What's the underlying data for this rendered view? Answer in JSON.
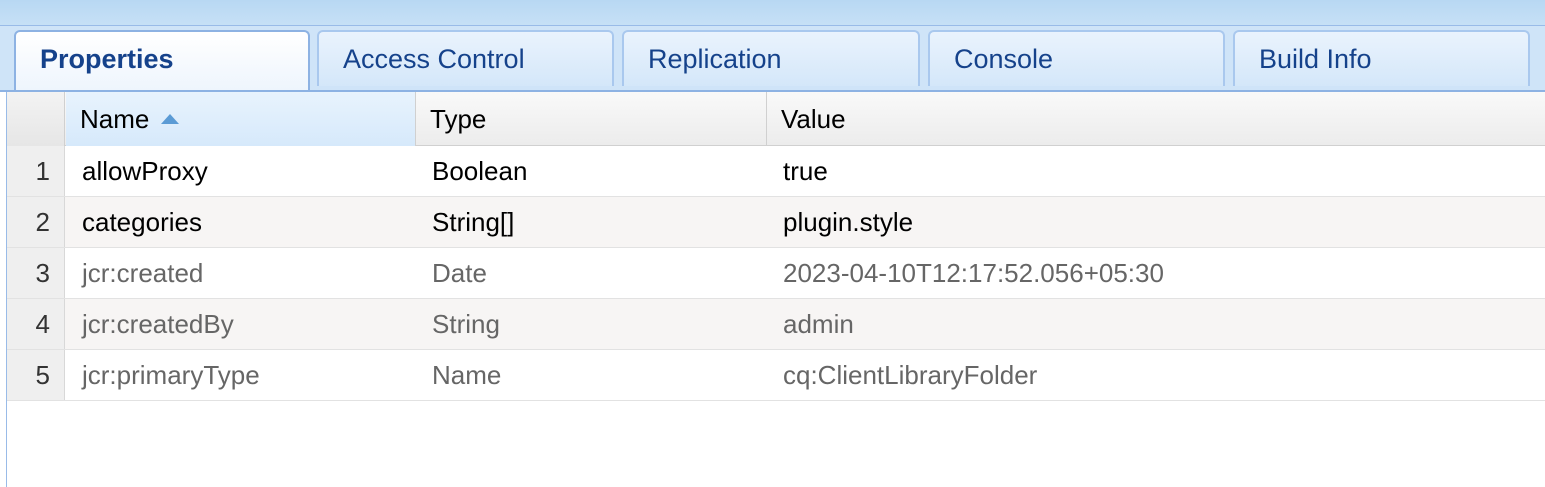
{
  "tabs": [
    {
      "label": "Properties",
      "active": true
    },
    {
      "label": "Access Control",
      "active": false
    },
    {
      "label": "Replication",
      "active": false
    },
    {
      "label": "Console",
      "active": false
    },
    {
      "label": "Build Info",
      "active": false
    }
  ],
  "grid": {
    "columns": {
      "name": "Name",
      "type": "Type",
      "value": "Value"
    },
    "sort": {
      "column": "Name",
      "direction": "ascending"
    },
    "rows": [
      {
        "num": "1",
        "name": "allowProxy",
        "type": "Boolean",
        "value": "true",
        "protected": false
      },
      {
        "num": "2",
        "name": "categories",
        "type": "String[]",
        "value": "plugin.style",
        "protected": false
      },
      {
        "num": "3",
        "name": "jcr:created",
        "type": "Date",
        "value": "2023-04-10T12:17:52.056+05:30",
        "protected": true
      },
      {
        "num": "4",
        "name": "jcr:createdBy",
        "type": "String",
        "value": "admin",
        "protected": true
      },
      {
        "num": "5",
        "name": "jcr:primaryType",
        "type": "Name",
        "value": "cq:ClientLibraryFolder",
        "protected": true
      }
    ]
  },
  "colors": {
    "tab_text": "#15428b",
    "protected_text": "#666666",
    "accent": "#5b9bd5"
  }
}
